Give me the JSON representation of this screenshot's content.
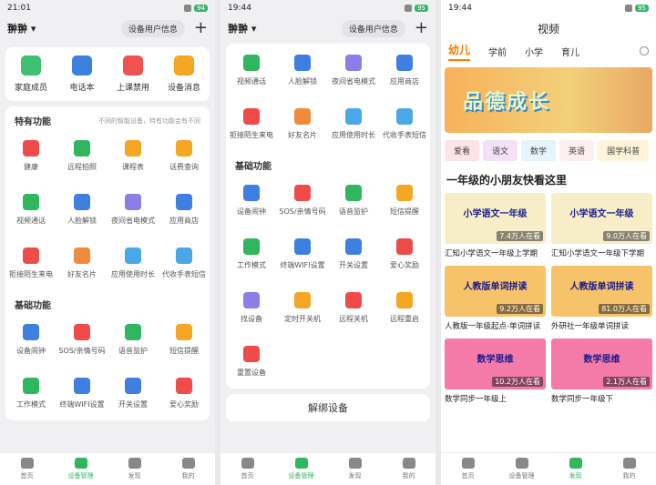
{
  "panel1": {
    "status": {
      "time": "21:01",
      "battery": "94"
    },
    "device_name": "翀翀",
    "device_info": "设备用户信息",
    "top_items": [
      {
        "label": "家庭成员",
        "icon": "family-icon",
        "color": "#3ec06f"
      },
      {
        "label": "电话本",
        "icon": "phonebook-icon",
        "color": "#3f7fe0"
      },
      {
        "label": "上课禁用",
        "icon": "class-disable-icon",
        "color": "#ef5252"
      },
      {
        "label": "设备消息",
        "icon": "message-icon",
        "color": "#f5a623"
      }
    ],
    "special_title": "特有功能",
    "special_note": "不同的智能设备，特有功能会有不同",
    "special_items": [
      {
        "label": "健康",
        "icon": "heart-icon",
        "color": "#ef4b4b"
      },
      {
        "label": "远程拍照",
        "icon": "camera-icon",
        "color": "#2fb65f"
      },
      {
        "label": "课程表",
        "icon": "schedule-icon",
        "color": "#f5a623"
      },
      {
        "label": "话费查询",
        "icon": "yuan-icon",
        "color": "#f5a623"
      },
      {
        "label": "视频通话",
        "icon": "video-call-icon",
        "color": "#2fb65f"
      },
      {
        "label": "人脸解锁",
        "icon": "face-unlock-icon",
        "color": "#3f7fe0"
      },
      {
        "label": "夜间省电模式",
        "icon": "moon-icon",
        "color": "#8a7ee8"
      },
      {
        "label": "应用商店",
        "icon": "store-icon",
        "color": "#3f7fe0"
      },
      {
        "label": "拒接陌生来电",
        "icon": "reject-call-icon",
        "color": "#ef4b4b"
      },
      {
        "label": "好友名片",
        "icon": "friend-card-icon",
        "color": "#f08a3c"
      },
      {
        "label": "应用使用时长",
        "icon": "clock-icon",
        "color": "#4aa8e8"
      },
      {
        "label": "代收手表短信",
        "icon": "sms-icon",
        "color": "#4aa8e8"
      }
    ],
    "basic_title": "基础功能",
    "basic_items": [
      {
        "label": "设备闹钟",
        "icon": "alarm-icon",
        "color": "#3f7fe0"
      },
      {
        "label": "SOS/亲情号码",
        "icon": "sos-icon",
        "color": "#ef4b4b"
      },
      {
        "label": "语音监护",
        "icon": "voice-monitor-icon",
        "color": "#2fb65f"
      },
      {
        "label": "短信提醒",
        "icon": "bell-icon",
        "color": "#f5a623"
      },
      {
        "label": "工作模式",
        "icon": "work-mode-icon",
        "color": "#2fb65f"
      },
      {
        "label": "终端WIFI设置",
        "icon": "wifi-icon",
        "color": "#3f7fe0"
      },
      {
        "label": "开关设置",
        "icon": "toggle-icon",
        "color": "#3f7fe0"
      },
      {
        "label": "爱心奖励",
        "icon": "love-icon",
        "color": "#ef4b4b"
      }
    ]
  },
  "panel2": {
    "status": {
      "time": "19:44",
      "battery": "95"
    },
    "device_name": "翀翀",
    "device_info": "设备用户信息",
    "items_top": [
      {
        "label": "视频通话",
        "icon": "video-call-icon",
        "color": "#2fb65f"
      },
      {
        "label": "人脸解锁",
        "icon": "face-unlock-icon",
        "color": "#3f7fe0"
      },
      {
        "label": "夜间省电模式",
        "icon": "moon-icon",
        "color": "#8a7ee8"
      },
      {
        "label": "应用商店",
        "icon": "store-icon",
        "color": "#3f7fe0"
      },
      {
        "label": "拒接陌生来电",
        "icon": "reject-call-icon",
        "color": "#ef4b4b"
      },
      {
        "label": "好友名片",
        "icon": "friend-card-icon",
        "color": "#f08a3c"
      },
      {
        "label": "应用使用时长",
        "icon": "clock-icon",
        "color": "#4aa8e8"
      },
      {
        "label": "代收手表短信",
        "icon": "sms-icon",
        "color": "#4aa8e8"
      }
    ],
    "basic_title": "基础功能",
    "basic_items": [
      {
        "label": "设备闹钟",
        "icon": "alarm-icon",
        "color": "#3f7fe0"
      },
      {
        "label": "SOS/亲情号码",
        "icon": "sos-icon",
        "color": "#ef4b4b"
      },
      {
        "label": "语音监护",
        "icon": "voice-monitor-icon",
        "color": "#2fb65f"
      },
      {
        "label": "短信提醒",
        "icon": "bell-icon",
        "color": "#f5a623"
      },
      {
        "label": "工作模式",
        "icon": "work-mode-icon",
        "color": "#2fb65f"
      },
      {
        "label": "终端WIFI设置",
        "icon": "wifi-icon",
        "color": "#3f7fe0"
      },
      {
        "label": "开关设置",
        "icon": "toggle-icon",
        "color": "#3f7fe0"
      },
      {
        "label": "爱心奖励",
        "icon": "love-icon",
        "color": "#ef4b4b"
      },
      {
        "label": "找设备",
        "icon": "find-device-icon",
        "color": "#8a7ee8"
      },
      {
        "label": "定时开关机",
        "icon": "timer-power-icon",
        "color": "#f5a623"
      },
      {
        "label": "远程关机",
        "icon": "power-off-icon",
        "color": "#ef4b4b"
      },
      {
        "label": "远程重启",
        "icon": "restart-icon",
        "color": "#f5a623"
      },
      {
        "label": "重置设备",
        "icon": "reset-icon",
        "color": "#ef4b4b"
      }
    ],
    "unbind_label": "解绑设备"
  },
  "panel3": {
    "status": {
      "time": "19:44",
      "battery": "95"
    },
    "title": "视频",
    "tabs": [
      "幼儿",
      "学前",
      "小学",
      "育儿"
    ],
    "hero_text": "品德成长",
    "chips": [
      {
        "label": "爱看",
        "color": "#fde3ea"
      },
      {
        "label": "语文",
        "color": "#f3e1f7"
      },
      {
        "label": "数学",
        "color": "#e6f4fb"
      },
      {
        "label": "英语",
        "color": "#fdeef2"
      },
      {
        "label": "国学科普",
        "color": "#fff3d9"
      }
    ],
    "section_title": "一年级的小朋友快看这里",
    "videos": [
      {
        "thumb_text": "小学语文一年级",
        "count": "7.4万人在看",
        "caption": "汇知小学语文一年级上学期",
        "bg": "#f7eec8"
      },
      {
        "thumb_text": "小学语文一年级",
        "count": "9.0万人在看",
        "caption": "汇知小学语文一年级下学期",
        "bg": "#f7eec8"
      },
      {
        "thumb_text": "人教版单词拼读",
        "count": "9.2万人在看",
        "caption": "人教版一年级起点-单词拼读",
        "bg": "#f6c36a"
      },
      {
        "thumb_text": "人教版单词拼读",
        "count": "81.0万人在看",
        "caption": "外研社一年级单词拼读",
        "bg": "#f6c36a"
      },
      {
        "thumb_text": "数学思维",
        "count": "10.2万人在看",
        "caption": "数学同步一年级上",
        "bg": "#f47aa8"
      },
      {
        "thumb_text": "数学思维",
        "count": "2.1万人在看",
        "caption": "数学同步一年级下",
        "bg": "#f47aa8"
      }
    ]
  },
  "nav": [
    "首页",
    "设备管理",
    "发现",
    "我的"
  ]
}
